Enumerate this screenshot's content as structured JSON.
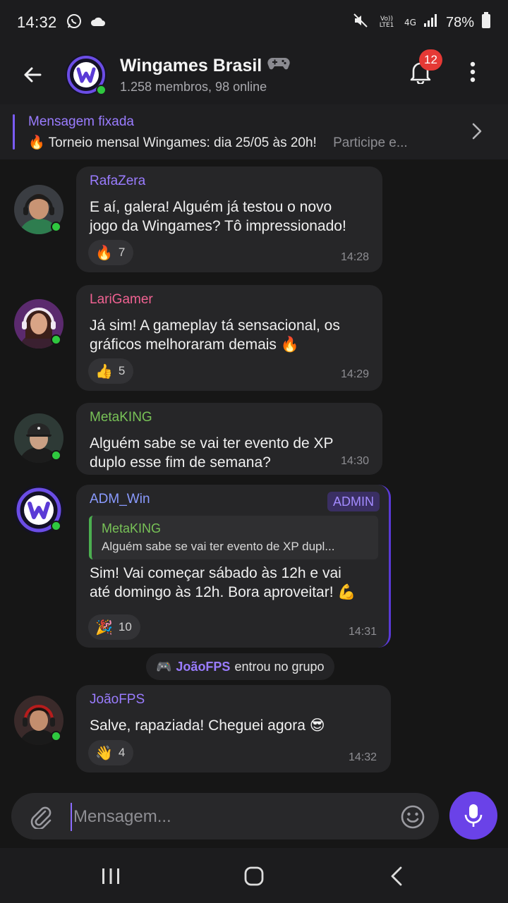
{
  "status_bar": {
    "time": "14:32",
    "battery": "78%",
    "volte_label": "Vo)) LTE1",
    "network_label": "4G"
  },
  "header": {
    "title": "Wingames Brasil",
    "title_icon": "gamepad-icon",
    "subtitle": "1.258 membros, 98 online",
    "notification_count": "12"
  },
  "pinned": {
    "label": "Mensagem fixada",
    "emoji": "🔥",
    "text": "Torneio mensal Wingames: dia 25/05 às 20h!",
    "preview_tail": "Participe e..."
  },
  "messages": [
    {
      "sender": "RafaZera",
      "sender_color": "#9a7cff",
      "line1": "E aí, galera! Alguém já testou o novo",
      "line2": "jogo da Wingames? Tô impressionado!",
      "reaction_emoji": "🔥",
      "reaction_count": "7",
      "time": "14:28"
    },
    {
      "sender": "LariGamer",
      "sender_color": "#f06292",
      "line1": "Já sim! A gameplay tá sensacional, os",
      "line2": "gráficos melhoraram demais 🔥",
      "reaction_emoji": "👍",
      "reaction_count": "5",
      "time": "14:29"
    },
    {
      "sender": "MetaKING",
      "sender_color": "#78c257",
      "line1": "Alguém sabe se vai ter evento de XP",
      "line2": "duplo esse fim de semana?",
      "time": "14:30"
    },
    {
      "sender": "ADM_Win",
      "sender_color": "#8a9bff",
      "badge": "ADMIN",
      "quote_sender": "MetaKING",
      "quote_text": "Alguém sabe se vai ter evento de XP dupl...",
      "line1": "Sim! Vai começar sábado às 12h e vai",
      "line2": "até domingo às 12h. Bora aproveitar! 💪",
      "reaction_emoji": "🎉",
      "reaction_count": "10",
      "time": "14:31"
    },
    {
      "sender": "JoãoFPS",
      "sender_color": "#9a7cff",
      "line1": "Salve, rapaziada! Cheguei agora 😎",
      "reaction_emoji": "👋",
      "reaction_count": "4",
      "time": "14:32"
    }
  ],
  "system_event": {
    "icon": "🎮",
    "name": "JoãoFPS",
    "text": "entrou no grupo"
  },
  "composer": {
    "placeholder": "Mensagem..."
  },
  "colors": {
    "accent": "#6a42e8",
    "online": "#2fc83f",
    "badge_red": "#e53935"
  }
}
